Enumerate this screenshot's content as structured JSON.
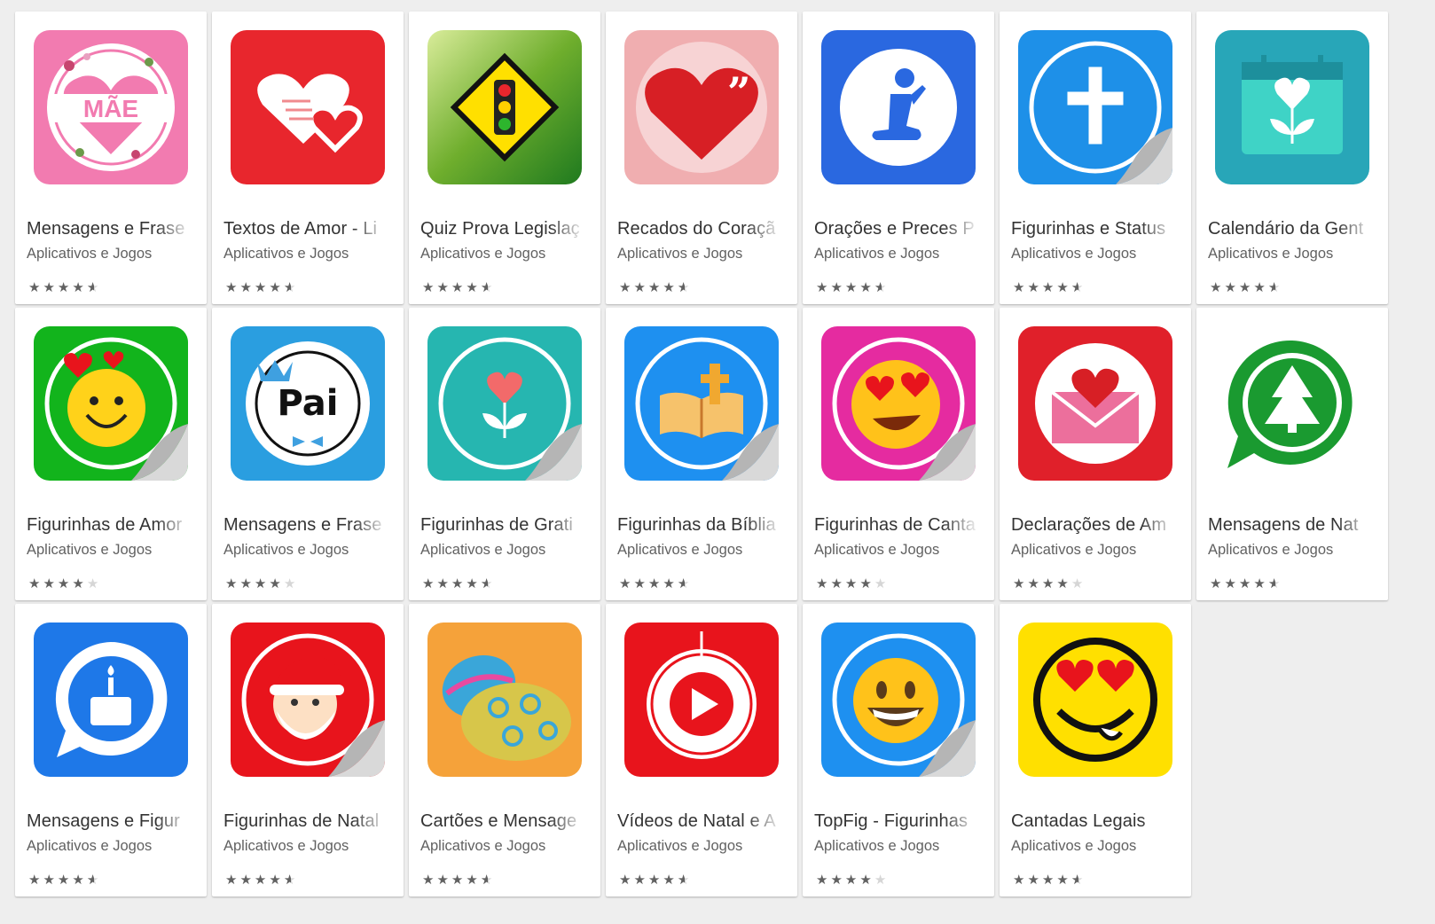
{
  "apps": [
    {
      "title": "Mensagens e Frase",
      "developer": "Aplicativos e Jogos",
      "rating": 4.5,
      "icon": "mae-heart-icon",
      "bg": "#f27bb0"
    },
    {
      "title": "Textos de Amor - Li",
      "developer": "Aplicativos e Jogos",
      "rating": 4.5,
      "icon": "love-hearts-icon",
      "bg": "#e8262d"
    },
    {
      "title": "Quiz Prova Legislaç",
      "developer": "Aplicativos e Jogos",
      "rating": 4.5,
      "icon": "traffic-sign-icon",
      "bg": "#6fae2d"
    },
    {
      "title": "Recados do Coraçã",
      "developer": "Aplicativos e Jogos",
      "rating": 4.5,
      "icon": "heart-quote-icon",
      "bg": "#f0aeb0"
    },
    {
      "title": "Orações e Preces P",
      "developer": "Aplicativos e Jogos",
      "rating": 4.5,
      "icon": "praying-person-icon",
      "bg": "#2a68e0"
    },
    {
      "title": "Figurinhas e Status",
      "developer": "Aplicativos e Jogos",
      "rating": 4.5,
      "icon": "cross-sticker-icon",
      "bg": "#1e90e8"
    },
    {
      "title": "Calendário da Gent",
      "developer": "Aplicativos e Jogos",
      "rating": 4.5,
      "icon": "calendar-flower-icon",
      "bg": "#28a6b8"
    },
    {
      "title": "Figurinhas de Amor",
      "developer": "Aplicativos e Jogos",
      "rating": 4.0,
      "icon": "smiley-hearts-sticker-icon",
      "bg": "#12b41c"
    },
    {
      "title": "Mensagens e Frase",
      "developer": "Aplicativos e Jogos",
      "rating": 4.0,
      "icon": "pai-crown-icon",
      "bg": "#2a9ee0"
    },
    {
      "title": "Figurinhas de Grati",
      "developer": "Aplicativos e Jogos",
      "rating": 4.5,
      "icon": "gratitude-flower-sticker-icon",
      "bg": "#26b6b0"
    },
    {
      "title": "Figurinhas da Bíblia",
      "developer": "Aplicativos e Jogos",
      "rating": 4.5,
      "icon": "bible-sticker-icon",
      "bg": "#1e90f0"
    },
    {
      "title": "Figurinhas de Canta",
      "developer": "Aplicativos e Jogos",
      "rating": 4.0,
      "icon": "heart-eyes-sticker-icon",
      "bg": "#e52ba0"
    },
    {
      "title": "Declarações de Am",
      "developer": "Aplicativos e Jogos",
      "rating": 4.0,
      "icon": "love-envelope-icon",
      "bg": "#e0202a"
    },
    {
      "title": "Mensagens de Nat",
      "developer": "Aplicativos e Jogos",
      "rating": 4.5,
      "icon": "christmas-tree-chat-icon",
      "bg": "#ffffff"
    },
    {
      "title": "Mensagens e Figur",
      "developer": "Aplicativos e Jogos",
      "rating": 4.5,
      "icon": "birthday-cake-chat-icon",
      "bg": "#1e78e8"
    },
    {
      "title": "Figurinhas de Natal",
      "developer": "Aplicativos e Jogos",
      "rating": 4.5,
      "icon": "santa-sticker-icon",
      "bg": "#e8141c"
    },
    {
      "title": "Cartões e Mensage",
      "developer": "Aplicativos e Jogos",
      "rating": 4.5,
      "icon": "easter-eggs-icon",
      "bg": "#f5a23a"
    },
    {
      "title": "Vídeos de Natal e A",
      "developer": "Aplicativos e Jogos",
      "rating": 4.5,
      "icon": "play-ornament-icon",
      "bg": "#e8141c"
    },
    {
      "title": "TopFig - Figurinhas",
      "developer": "Aplicativos e Jogos",
      "rating": 4.0,
      "icon": "grinning-emoji-sticker-icon",
      "bg": "#1e90f0"
    },
    {
      "title": "Cantadas Legais",
      "developer": "Aplicativos e Jogos",
      "rating": 4.5,
      "icon": "heart-eyes-face-icon",
      "bg": "#ffe000"
    }
  ]
}
